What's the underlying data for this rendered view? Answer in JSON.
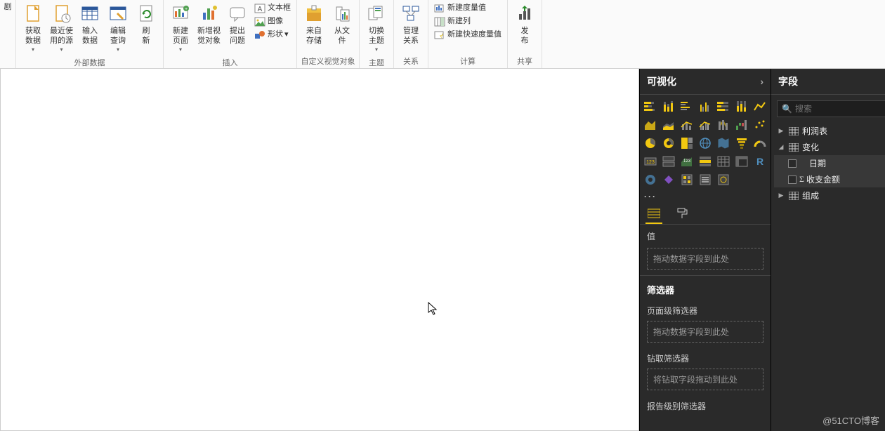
{
  "ribbon": {
    "groups": {
      "external_data": {
        "label": "外部数据",
        "get_data": "获取\n数据",
        "recent": "最近使\n用的源",
        "enter_data": "输入\n数据",
        "edit_queries": "编辑\n查询",
        "refresh": "刷\n新"
      },
      "insert": {
        "label": "插入",
        "new_page": "新建\n页面",
        "new_visual": "新增视\n觉对象",
        "ask_question": "提出\n问题",
        "text_box": "文本框",
        "image": "图像",
        "shapes": "形状"
      },
      "custom_visuals": {
        "label": "自定义视觉对象",
        "from_store": "来自\n存储",
        "from_file": "从文\n件"
      },
      "themes": {
        "label": "主题",
        "switch_theme": "切换\n主题"
      },
      "relationships": {
        "label": "关系",
        "manage_rel": "管理\n关系"
      },
      "calculations": {
        "label": "计算",
        "new_measure": "新建度量值",
        "new_column": "新建列",
        "new_quick": "新建快速度量值"
      },
      "share": {
        "label": "共享",
        "publish": "发\n布"
      }
    },
    "edge_label": "剧"
  },
  "viz_panel": {
    "title": "可视化",
    "more": "···",
    "values_label": "值",
    "values_placeholder": "拖动数据字段到此处",
    "filters_header": "筛选器",
    "page_filters": "页面级筛选器",
    "page_filters_placeholder": "拖动数据字段到此处",
    "drill_filters": "钻取筛选器",
    "drill_placeholder": "将钻取字段拖动到此处",
    "report_filters": "报告级别筛选器"
  },
  "fields_panel": {
    "title": "字段",
    "search_placeholder": "搜索",
    "tables": {
      "profit": "利润表",
      "change": "变化",
      "change_fields": {
        "date": "日期",
        "amount": "收支金额"
      },
      "composition": "组成"
    }
  },
  "watermark": "@51CTO博客"
}
